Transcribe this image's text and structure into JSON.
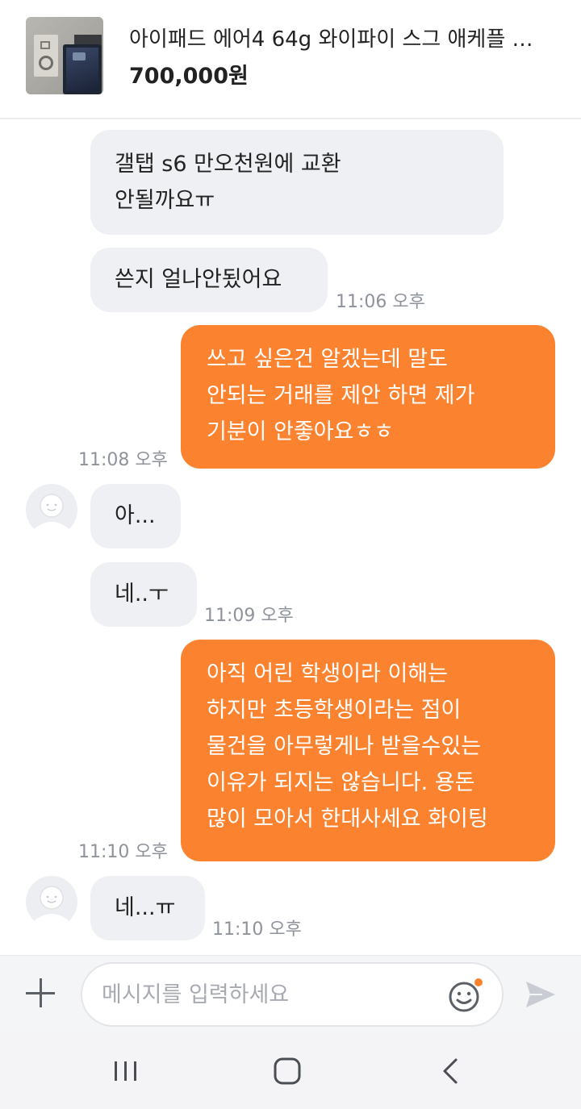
{
  "product": {
    "title": "아이패드 에어4 64g 와이파이 스그 애케플 …",
    "price": "700,000원"
  },
  "messages": [
    {
      "side": "in",
      "lines": [
        "갤탭 s6 만오천원에 교환",
        "안될까요ㅠ"
      ]
    },
    {
      "side": "in",
      "lines": [
        "쓴지 얼나안됬어요"
      ],
      "time": "11:06 오후"
    },
    {
      "side": "out",
      "lines": [
        "쓰고 싶은건 알겠는데 말도",
        "안되는 거래를 제안 하면 제가",
        "기분이 안좋아요ㅎㅎ"
      ],
      "time": "11:08 오후"
    },
    {
      "side": "in",
      "lines": [
        "아..."
      ]
    },
    {
      "side": "in",
      "lines": [
        "네..ㅜ"
      ],
      "time": "11:09 오후"
    },
    {
      "side": "out",
      "lines": [
        "아직 어린 학생이라 이해는",
        "하지만 초등학생이라는 점이",
        "물건을 아무렇게나 받을수있는",
        "이유가 되지는 않습니다. 용돈",
        "많이 모아서 한대사세요 화이팅"
      ],
      "time": "11:10 오후"
    },
    {
      "side": "in",
      "lines": [
        "네...ㅠ"
      ],
      "time": "11:10 오후"
    }
  ],
  "input": {
    "placeholder": "메시지를 입력하세요",
    "value": ""
  },
  "icons": {
    "attach": "plus-icon",
    "emoji": "smiley-icon",
    "send": "send-arrow-icon",
    "nav_recent": "recent-apps-icon",
    "nav_home": "home-icon",
    "nav_back": "back-icon"
  },
  "colors": {
    "outgoing_bubble": "#fb8330",
    "incoming_bubble": "#eff0f3",
    "notification_dot": "#fb8330"
  }
}
